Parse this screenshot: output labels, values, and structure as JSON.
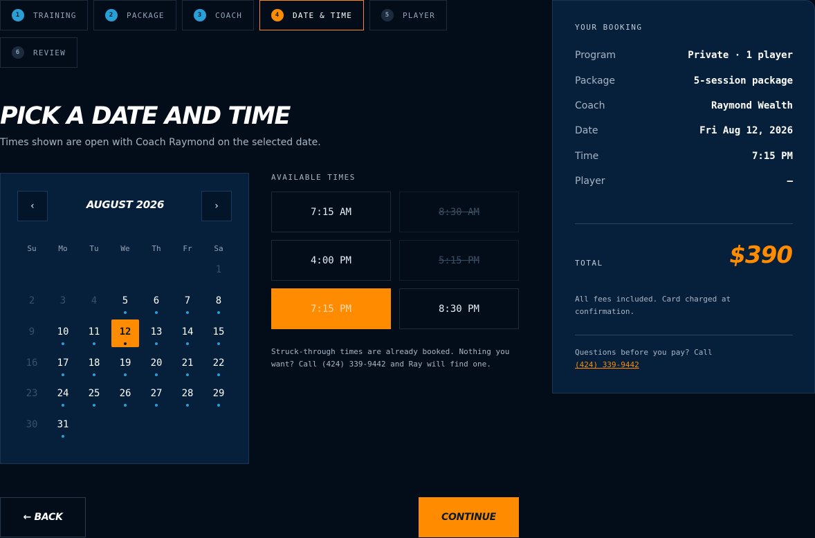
{
  "stepper": [
    {
      "num": "1",
      "label": "TRAINING",
      "state": "done"
    },
    {
      "num": "2",
      "label": "PACKAGE",
      "state": "done"
    },
    {
      "num": "3",
      "label": "COACH",
      "state": "done"
    },
    {
      "num": "4",
      "label": "DATE & TIME",
      "state": "active"
    },
    {
      "num": "5",
      "label": "PLAYER",
      "state": "todo"
    },
    {
      "num": "6",
      "label": "REVIEW",
      "state": "todo"
    }
  ],
  "page": {
    "title": "PICK A DATE AND TIME",
    "subtitle": "Times shown are open with Coach Raymond on the selected date."
  },
  "calendar": {
    "prev_icon": "‹",
    "next_icon": "›",
    "month_label": "AUGUST 2026",
    "weekdays": [
      "Su",
      "Mo",
      "Tu",
      "We",
      "Th",
      "Fr",
      "Sa"
    ],
    "days": [
      {
        "n": "1",
        "state": "disabled"
      },
      {
        "n": "2",
        "state": "disabled"
      },
      {
        "n": "3",
        "state": "disabled"
      },
      {
        "n": "4",
        "state": "disabled"
      },
      {
        "n": "5",
        "state": "available"
      },
      {
        "n": "6",
        "state": "available"
      },
      {
        "n": "7",
        "state": "available"
      },
      {
        "n": "8",
        "state": "available"
      },
      {
        "n": "9",
        "state": "disabled"
      },
      {
        "n": "10",
        "state": "available"
      },
      {
        "n": "11",
        "state": "available"
      },
      {
        "n": "12",
        "state": "selected"
      },
      {
        "n": "13",
        "state": "available"
      },
      {
        "n": "14",
        "state": "available"
      },
      {
        "n": "15",
        "state": "available"
      },
      {
        "n": "16",
        "state": "disabled"
      },
      {
        "n": "17",
        "state": "available"
      },
      {
        "n": "18",
        "state": "available"
      },
      {
        "n": "19",
        "state": "available"
      },
      {
        "n": "20",
        "state": "available"
      },
      {
        "n": "21",
        "state": "available"
      },
      {
        "n": "22",
        "state": "available"
      },
      {
        "n": "23",
        "state": "disabled"
      },
      {
        "n": "24",
        "state": "available"
      },
      {
        "n": "25",
        "state": "available"
      },
      {
        "n": "26",
        "state": "available"
      },
      {
        "n": "27",
        "state": "available"
      },
      {
        "n": "28",
        "state": "available"
      },
      {
        "n": "29",
        "state": "available"
      },
      {
        "n": "30",
        "state": "disabled"
      },
      {
        "n": "31",
        "state": "available"
      }
    ]
  },
  "times": {
    "label": "AVAILABLE TIMES",
    "slots": [
      {
        "time": "7:15 AM",
        "state": "open"
      },
      {
        "time": "8:30 AM",
        "state": "booked"
      },
      {
        "time": "4:00 PM",
        "state": "open"
      },
      {
        "time": "5:15 PM",
        "state": "booked"
      },
      {
        "time": "7:15 PM",
        "state": "selected"
      },
      {
        "time": "8:30 PM",
        "state": "open"
      }
    ],
    "note": "Struck-through times are already booked. Nothing you want? Call (424) 339-9442 and Ray will find one."
  },
  "actions": {
    "back_label": "← BACK",
    "continue_label": "CONTINUE"
  },
  "booking": {
    "title": "YOUR BOOKING",
    "rows": [
      {
        "key": "Program",
        "value": "Private · 1 player"
      },
      {
        "key": "Package",
        "value": "5-session package"
      },
      {
        "key": "Coach",
        "value": "Raymond Wealth"
      },
      {
        "key": "Date",
        "value": "Fri Aug 12, 2026"
      },
      {
        "key": "Time",
        "value": "7:15 PM"
      },
      {
        "key": "Player",
        "value": "—"
      }
    ],
    "total_label": "TOTAL",
    "total_value": "$390",
    "fees_note": "All fees included. Card charged at confirmation.",
    "questions_text": "Questions before you pay? Call",
    "phone": "(424) 339-9442"
  },
  "colors": {
    "accent": "#ff8c00",
    "done_step": "#2a9fd6",
    "background": "#020d19",
    "panel": "#06203c"
  }
}
